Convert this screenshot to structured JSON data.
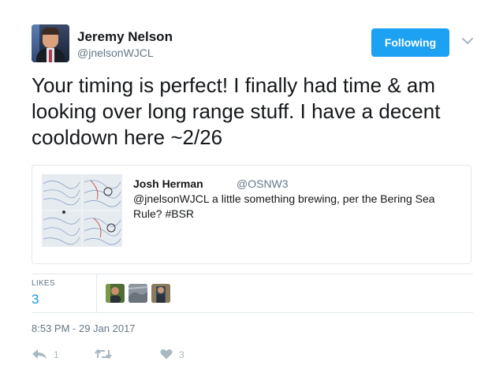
{
  "author": {
    "name": "Jeremy Nelson",
    "handle": "@jnelsonWJCL"
  },
  "follow_button": {
    "label": "Following"
  },
  "tweet": {
    "text": "Your timing is perfect! I finally had time & am looking over long range stuff. I have a decent cooldown here ~2/26"
  },
  "quoted_tweet": {
    "name": "Josh Herman",
    "handle": "@OSNW3",
    "text": "@jnelsonWJCL a little something brewing, per the Bering Sea Rule? #BSR"
  },
  "stats": {
    "likes_label": "LIKES",
    "likes_count": "3"
  },
  "timestamp": "8:53 PM - 29 Jan 2017",
  "actions": {
    "reply_count": "1",
    "retweet_count": "",
    "like_count": "3"
  },
  "colors": {
    "accent": "#1da1f2",
    "link": "#1b95e0",
    "muted": "#657786",
    "border": "#e1e8ed",
    "icon": "#aab8c2"
  },
  "icons": {
    "caret": "chevron-down-icon",
    "reply": "reply-icon",
    "retweet": "retweet-icon",
    "like": "heart-icon"
  }
}
